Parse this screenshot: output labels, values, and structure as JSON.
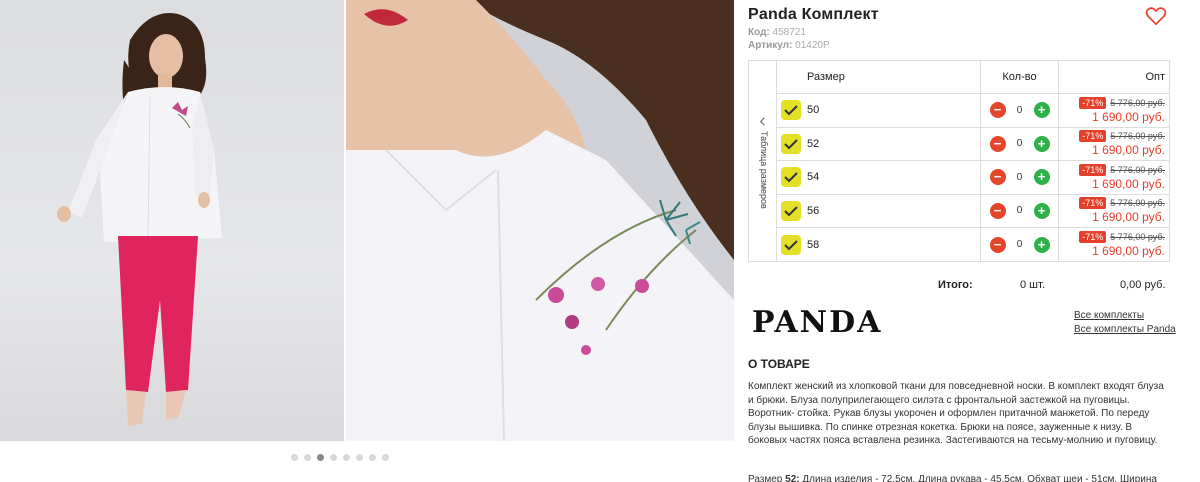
{
  "product": {
    "title": "Panda Комплект",
    "code_label": "Код:",
    "code_value": "458721",
    "article_label": "Артикул:",
    "article_value": "01420P"
  },
  "gallery": {
    "dot_count": 8,
    "active_dot": 3
  },
  "table": {
    "size_table_tab": "Таблица размеров",
    "headers": {
      "size": "Размер",
      "qty": "Кол-во",
      "price": "Опт"
    },
    "rows": [
      {
        "size": "50",
        "qty": "0",
        "discount": "-71%",
        "old_price": "5 776,00 руб.",
        "new_price": "1 690,00 руб."
      },
      {
        "size": "52",
        "qty": "0",
        "discount": "-71%",
        "old_price": "5 776,00 руб.",
        "new_price": "1 690,00 руб."
      },
      {
        "size": "54",
        "qty": "0",
        "discount": "-71%",
        "old_price": "5 776,00 руб.",
        "new_price": "1 690,00 руб."
      },
      {
        "size": "56",
        "qty": "0",
        "discount": "-71%",
        "old_price": "5 776,00 руб.",
        "new_price": "1 690,00 руб."
      },
      {
        "size": "58",
        "qty": "0",
        "discount": "-71%",
        "old_price": "5 776,00 руб.",
        "new_price": "1 690,00 руб."
      }
    ]
  },
  "total": {
    "label": "Итого:",
    "qty": "0 шт.",
    "sum": "0,00 руб."
  },
  "brand": {
    "logo_text": "PANDA",
    "link_all": "Все комплекты",
    "link_brand": "Все комплекты Panda"
  },
  "about": {
    "heading": "О ТОВАРЕ",
    "text": "Комплект женский из хлопковой ткани для повседневной носки. В комплект входят блуза и брюки. Блуза полуприлегающего силэта с фронтальной застежкой на пуговицы. Воротник- стойка. Рукав блузы укорочен и оформлен притачной манжетой. По переду блузы вышивка. По спинке отрезная кокетка. Брюки на поясе, зауженные к низу. В боковых частях пояса вставлена резинка. Застегиваются на тесьму-молнию и пуговицу.",
    "size_prefix": "Размер",
    "size_bold": "52:",
    "size_line": "Длина изделия - 72,5см. Длина рукава - 45,5см. Обхват шеи - 51см. Ширина"
  },
  "colors": {
    "accent_red": "#e5402b",
    "plus_green": "#2fb14a",
    "check_yellow": "#e5df2a",
    "pants_pink": "#e0245e"
  },
  "icons": [
    "heart-icon",
    "chevron-left-icon",
    "check-icon",
    "minus-icon",
    "plus-icon"
  ]
}
